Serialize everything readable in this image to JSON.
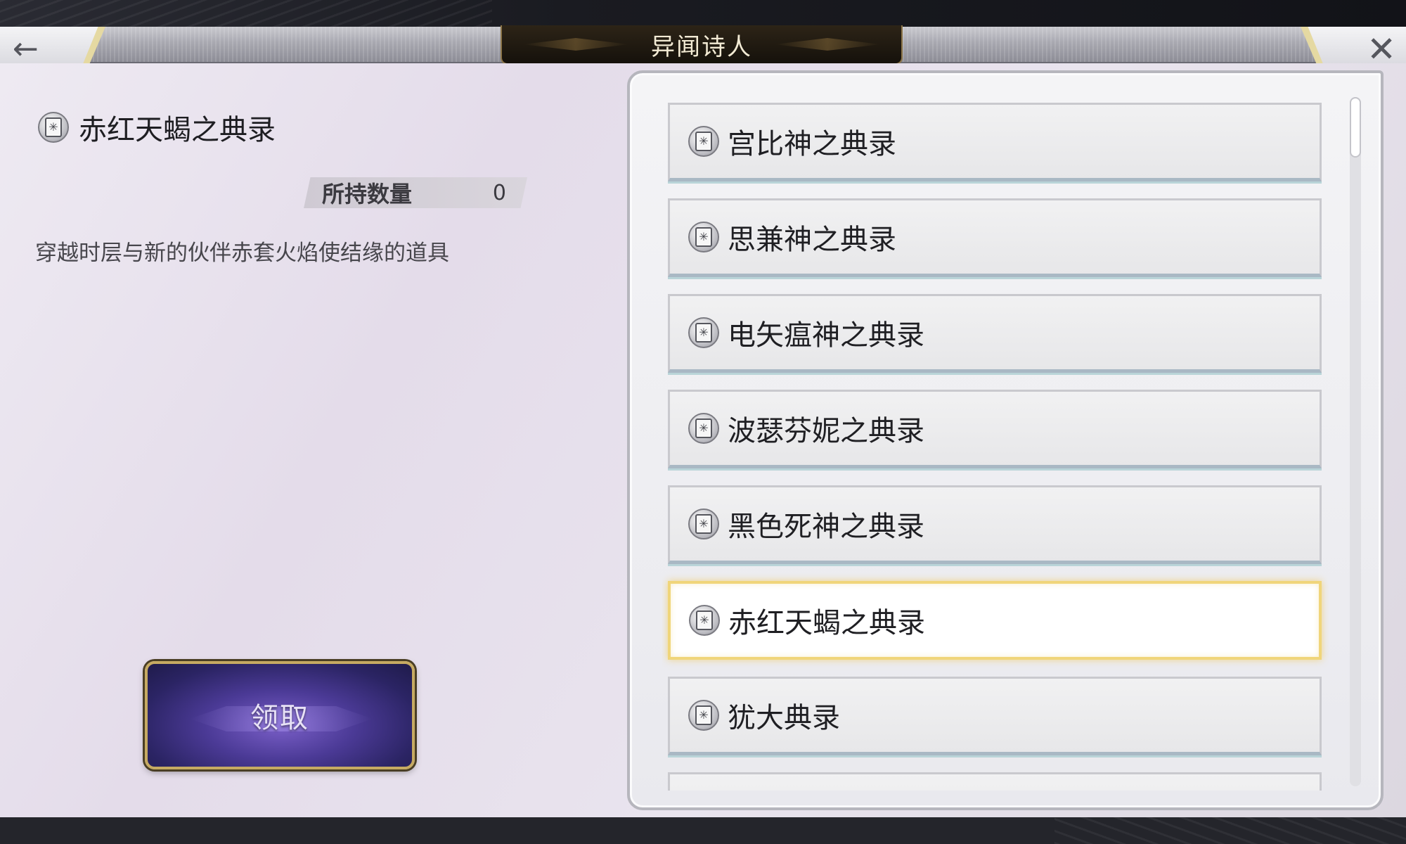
{
  "header": {
    "title": "异闻诗人",
    "back_icon": "left-arrow-icon",
    "close_icon": "close-x-icon"
  },
  "detail": {
    "title": "赤红天蝎之典录",
    "icon": "book-icon",
    "quantity_label": "所持数量",
    "quantity_value": "0",
    "description": "穿越时层与新的伙伴赤套火焰使结缘的道具",
    "claim_button": "领取"
  },
  "list": {
    "items": [
      {
        "label": "宫比神之典录"
      },
      {
        "label": "思兼神之典录"
      },
      {
        "label": "电矢瘟神之典录"
      },
      {
        "label": "波瑟芬妮之典录"
      },
      {
        "label": "黑色死神之典录"
      },
      {
        "label": "赤红天蝎之典录",
        "selected": true
      },
      {
        "label": "犹大典录"
      }
    ]
  }
}
